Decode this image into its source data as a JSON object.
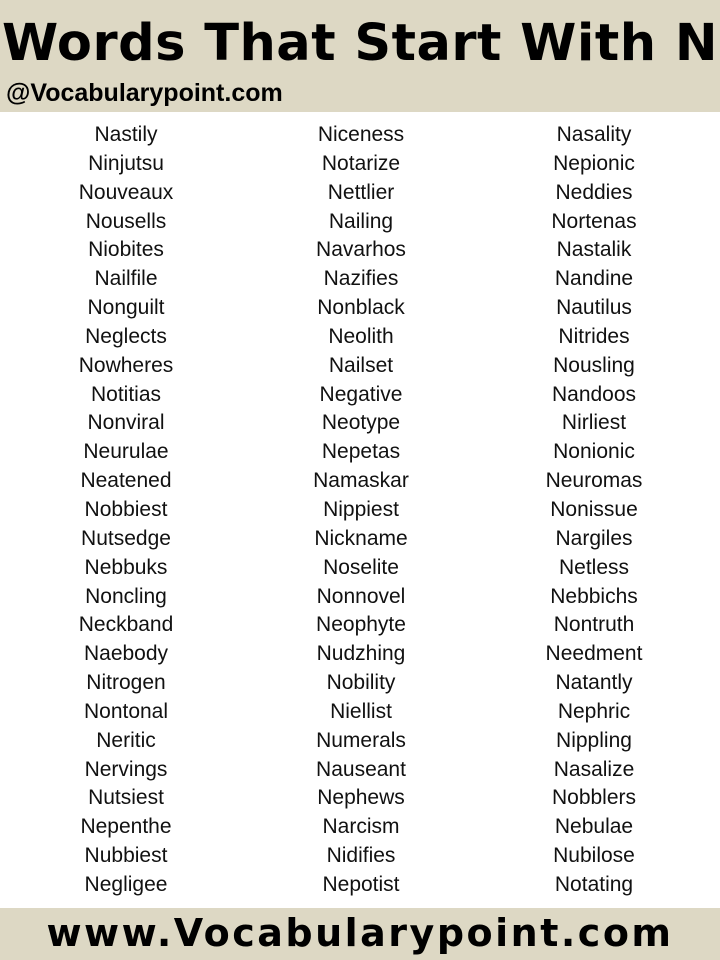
{
  "header": {
    "title": "Words That Start With N",
    "handle": "@Vocabularypoint.com"
  },
  "columns": [
    [
      "Nastily",
      "Ninjutsu",
      "Nouveaux",
      "Nousells",
      "Niobites",
      "Nailfile",
      "Nonguilt",
      "Neglects",
      "Nowheres",
      "Notitias",
      "Nonviral",
      "Neurulae",
      "Neatened",
      "Nobbiest",
      "Nutsedge",
      "Nebbuks",
      "Noncling",
      "Neckband",
      "Naebody",
      "Nitrogen",
      "Nontonal",
      "Neritic",
      "Nervings",
      "Nutsiest",
      "Nepenthe",
      "Nubbiest",
      "Negligee"
    ],
    [
      "Niceness",
      "Notarize",
      "Nettlier",
      "Nailing",
      "Navarhos",
      "Nazifies",
      "Nonblack",
      "Neolith",
      "Nailset",
      "Negative",
      "Neotype",
      "Nepetas",
      "Namaskar",
      "Nippiest",
      "Nickname",
      "Noselite",
      "Nonnovel",
      "Neophyte",
      "Nudzhing",
      "Nobility",
      "Niellist",
      "Numerals",
      "Nauseant",
      "Nephews",
      "Narcism",
      "Nidifies",
      "Nepotist"
    ],
    [
      "Nasality",
      "Nepionic",
      "Neddies",
      "Nortenas",
      "Nastalik",
      "Nandine",
      "Nautilus",
      "Nitrides",
      "Nousling",
      "Nandoos",
      "Nirliest",
      "Nonionic",
      "Neuromas",
      "Nonissue",
      "Nargiles",
      "Netless",
      "Nebbichs",
      "Nontruth",
      "Needment",
      "Natantly",
      "Nephric",
      "Nippling",
      "Nasalize",
      "Nobblers",
      "Nebulae",
      "Nubilose",
      "Notating"
    ]
  ],
  "footer": {
    "site": "www.Vocabularypoint.com"
  },
  "colors": {
    "banner_bg": "#ddd8c4",
    "text": "#000000",
    "page_bg": "#ffffff"
  }
}
